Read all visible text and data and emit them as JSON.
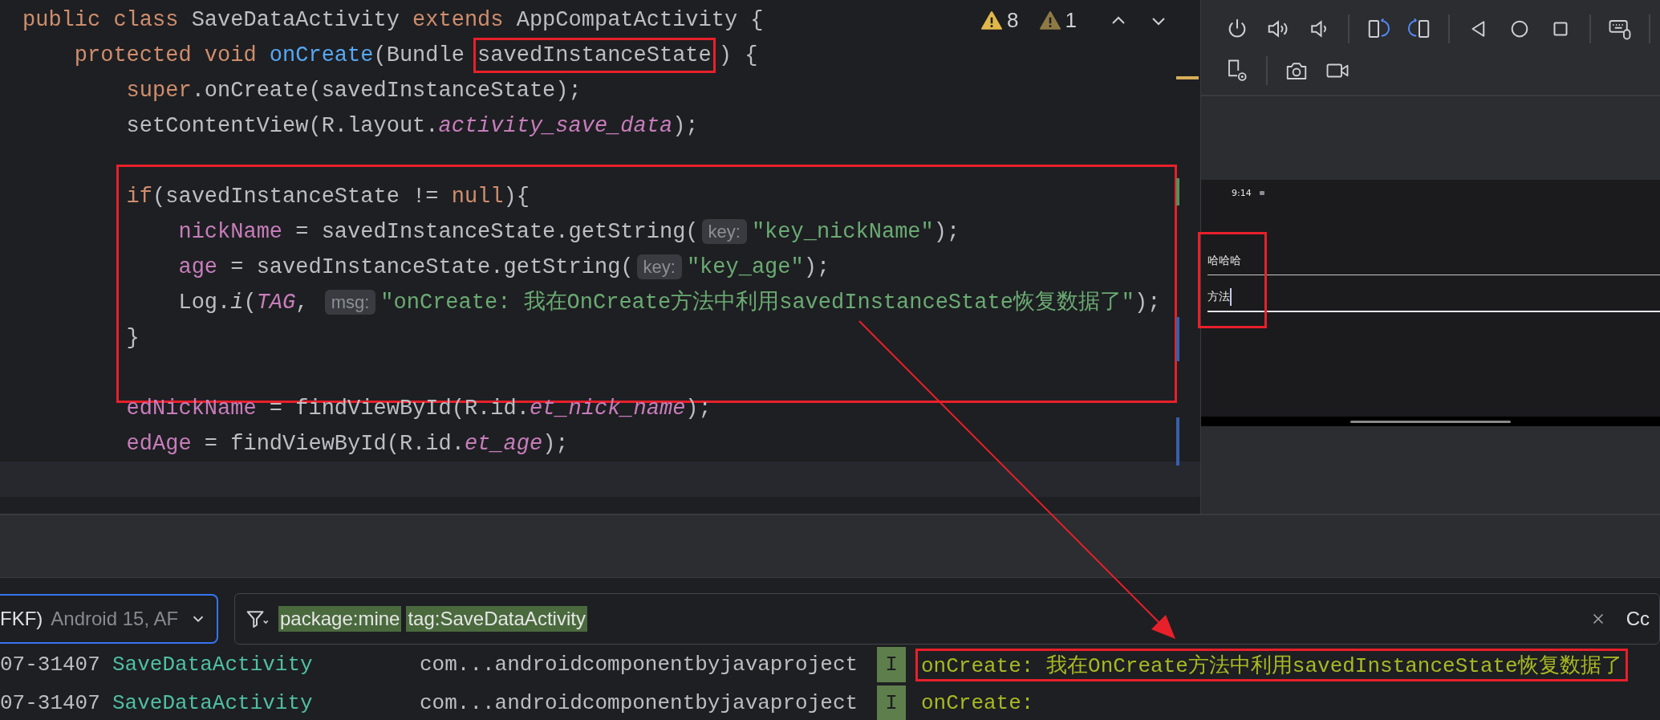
{
  "editor": {
    "inspections": [
      {
        "kind": "warning",
        "count": "8"
      },
      {
        "kind": "weak_warning",
        "count": "1"
      }
    ],
    "blocks": [
      {
        "boxed": false,
        "lines": [
          {
            "current": false,
            "tokens": [
              {
                "kind": "keyword",
                "text": "public class "
              },
              {
                "kind": "plain",
                "text": "SaveDataActivity "
              },
              {
                "kind": "keyword",
                "text": "extends "
              },
              {
                "kind": "plain",
                "text": "AppCompatActivity {"
              }
            ]
          },
          {
            "current": false,
            "tokens": [
              {
                "kind": "keyword",
                "text": "    protected void "
              },
              {
                "kind": "method",
                "text": "onCreate"
              },
              {
                "kind": "plain",
                "text": "(Bundle "
              },
              {
                "kind": "boxed",
                "text": "savedInstanceState"
              },
              {
                "kind": "plain",
                "text": ") {"
              }
            ]
          },
          {
            "current": false,
            "tokens": [
              {
                "kind": "keyword",
                "text": "        super"
              },
              {
                "kind": "plain",
                "text": ".onCreate(savedInstanceState);"
              }
            ]
          },
          {
            "current": false,
            "tokens": [
              {
                "kind": "plain",
                "text": "        setContentView(R.layout."
              },
              {
                "kind": "static",
                "text": "activity_save_data"
              },
              {
                "kind": "plain",
                "text": ");"
              }
            ]
          },
          {
            "current": false
          }
        ]
      },
      {
        "boxed": true,
        "lines": [
          {
            "current": false,
            "tokens": [
              {
                "kind": "keyword",
                "text": "        if"
              },
              {
                "kind": "plain",
                "text": "(savedInstanceState != "
              },
              {
                "kind": "keyword",
                "text": "null"
              },
              {
                "kind": "plain",
                "text": "){"
              }
            ]
          },
          {
            "current": false,
            "tokens": [
              {
                "kind": "field",
                "text": "            nickName"
              },
              {
                "kind": "plain",
                "text": " = savedInstanceState.getString("
              },
              {
                "kind": "hint",
                "text": "key:"
              },
              {
                "kind": "string",
                "text": "\"key_nickName\""
              },
              {
                "kind": "plain",
                "text": ");"
              }
            ]
          },
          {
            "current": false,
            "tokens": [
              {
                "kind": "field",
                "text": "            age"
              },
              {
                "kind": "plain",
                "text": " = savedInstanceState.getString("
              },
              {
                "kind": "hint",
                "text": "key:"
              },
              {
                "kind": "string",
                "text": "\"key_age\""
              },
              {
                "kind": "plain",
                "text": ");"
              }
            ]
          },
          {
            "current": false,
            "tokens": [
              {
                "kind": "plain",
                "text": "            Log."
              },
              {
                "kind": "italic",
                "text": "i"
              },
              {
                "kind": "plain",
                "text": "("
              },
              {
                "kind": "static",
                "text": "TAG"
              },
              {
                "kind": "plain",
                "text": ", "
              },
              {
                "kind": "hint",
                "text": "msg:"
              },
              {
                "kind": "string",
                "text": "\"onCreate: 我在OnCreate方法中利用savedInstanceState恢复数据了\""
              },
              {
                "kind": "plain",
                "text": ");"
              }
            ]
          },
          {
            "current": false,
            "tokens": [
              {
                "kind": "plain",
                "text": "        }"
              }
            ]
          },
          {
            "current": false
          }
        ]
      },
      {
        "boxed": false,
        "lines": [
          {
            "current": false,
            "tokens": [
              {
                "kind": "field",
                "text": "        edNickName"
              },
              {
                "kind": "plain",
                "text": " = findViewById(R.id."
              },
              {
                "kind": "static",
                "text": "et_nick_name"
              },
              {
                "kind": "plain",
                "text": ");"
              }
            ]
          },
          {
            "current": false,
            "tokens": [
              {
                "kind": "field",
                "text": "        edAge"
              },
              {
                "kind": "plain",
                "text": " = findViewById(R.id."
              },
              {
                "kind": "static",
                "text": "et_age"
              },
              {
                "kind": "plain",
                "text": ");"
              }
            ]
          },
          {
            "current": true
          }
        ]
      }
    ]
  },
  "emulator": {
    "status_time": "9:14",
    "fields_boxed": true,
    "fields": [
      {
        "value": "哈哈哈",
        "focused": false
      },
      {
        "value": "方法",
        "focused": true
      }
    ]
  },
  "logcat": {
    "device": {
      "id_fragment": "FKF)",
      "label": "Android 15, AF"
    },
    "filter_terms": [
      "package:mine",
      "tag:SaveDataActivity"
    ],
    "match_case": "Cc",
    "rows": [
      {
        "process": "07-31407",
        "tag": "SaveDataActivity",
        "package": "com...androidcomponentbyjavaproject",
        "level": "I",
        "message": "onCreate: 我在OnCreate方法中利用savedInstanceState恢复数据了",
        "boxed": true
      },
      {
        "process": "07-31407",
        "tag": "SaveDataActivity",
        "package": "com...androidcomponentbyjavaproject",
        "level": "I",
        "message": "onCreate:",
        "boxed": false
      }
    ]
  }
}
